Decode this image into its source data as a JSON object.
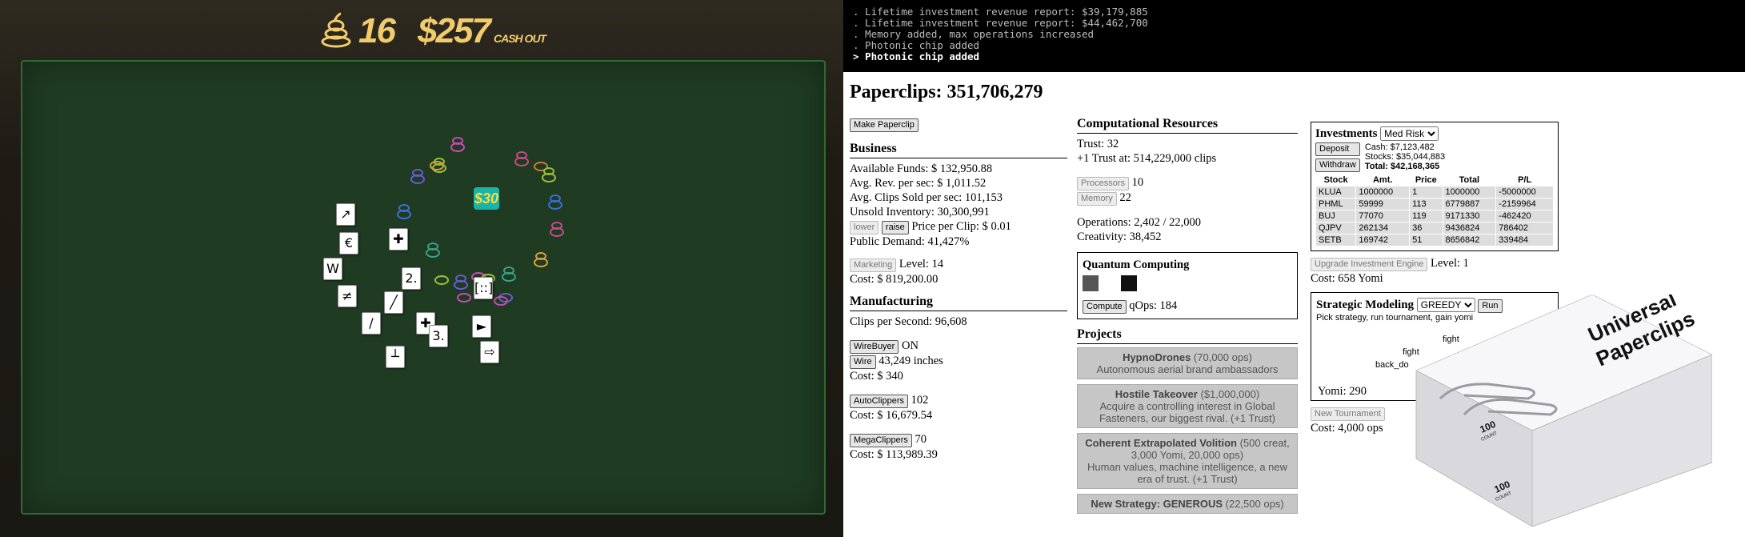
{
  "game": {
    "player_count": "16",
    "money": "$257",
    "cash_out_label": "CASH OUT",
    "chip_label": "$30",
    "cards": [
      "↗",
      "€",
      "W",
      "≠",
      "✚",
      "2.",
      "╱",
      "/",
      "✚",
      "3.",
      "►",
      "⇨",
      "┴",
      "[::]",
      "┘",
      "∕"
    ]
  },
  "console": {
    "lines": [
      ". Lifetime investment revenue report: $39,179,885",
      ". Lifetime investment revenue report: $44,462,700",
      ". Memory added, max operations increased",
      ". Photonic chip added"
    ],
    "last_line": "> Photonic chip added"
  },
  "paperclips": {
    "title": "Paperclips: 351,706,279",
    "make_button": "Make Paperclip",
    "business": {
      "heading": "Business",
      "funds": "Available Funds: $ 132,950.88",
      "rev": "Avg. Rev. per sec: $ 1,011.52",
      "sold": "Avg. Clips Sold per sec: 101,153",
      "unsold": "Unsold Inventory: 30,300,991",
      "lower": "lower",
      "raise": "raise",
      "price": "Price per Clip: $ 0.01",
      "demand": "Public Demand: 41,427%",
      "marketing_btn": "Marketing",
      "marketing_level": "Level: 14",
      "marketing_cost": "Cost: $ 819,200.00"
    },
    "manufacturing": {
      "heading": "Manufacturing",
      "cps": "Clips per Second: 96,608",
      "wirebuyer_btn": "WireBuyer",
      "wirebuyer_state": "ON",
      "wire_btn": "Wire",
      "wire_amt": "43,249 inches",
      "wire_cost": "Cost: $ 340",
      "auto_btn": "AutoClippers",
      "auto_count": "102",
      "auto_cost": "Cost: $ 16,679.54",
      "mega_btn": "MegaClippers",
      "mega_count": "70",
      "mega_cost": "Cost: $ 113,989.39"
    },
    "computational": {
      "heading": "Computational Resources",
      "trust": "Trust: 32",
      "next_trust": "+1 Trust at: 514,229,000 clips",
      "processors_btn": "Processors",
      "processors": "10",
      "memory_btn": "Memory",
      "memory": "22",
      "operations": "Operations: 2,402 / 22,000",
      "creativity": "Creativity: 38,452"
    },
    "quantum": {
      "heading": "Quantum Computing",
      "compute_btn": "Compute",
      "qops": "qOps: 184"
    },
    "projects": {
      "heading": "Projects",
      "items": [
        {
          "title": "HypnoDrones",
          "cost": "(70,000 ops)",
          "desc": "Autonomous aerial brand ambassadors"
        },
        {
          "title": "Hostile Takeover",
          "cost": "($1,000,000)",
          "desc": "Acquire a controlling interest in Global Fasteners, our biggest rival. (+1 Trust)"
        },
        {
          "title": "Coherent Extrapolated Volition",
          "cost": "(500 creat, 3,000 Yomi, 20,000 ops)",
          "desc": "Human values, machine intelligence, a new era of trust. (+1 Trust)"
        },
        {
          "title": "New Strategy: GENEROUS",
          "cost": "(22,500 ops)",
          "desc": ""
        }
      ]
    },
    "investments": {
      "heading": "Investments",
      "risk": "Med Risk",
      "deposit_btn": "Deposit",
      "withdraw_btn": "Withdraw",
      "cash": "Cash: $7,123,482",
      "stocks": "Stocks: $35,044,883",
      "total": "Total: $42,168,365",
      "columns": [
        "Stock",
        "Amt.",
        "Price",
        "Total",
        "P/L"
      ],
      "rows": [
        [
          "KLUA",
          "1000000",
          "1",
          "1000000",
          "-5000000"
        ],
        [
          "PHML",
          "59999",
          "113",
          "6779887",
          "-2159964"
        ],
        [
          "BUJ",
          "77070",
          "119",
          "9171330",
          "-462420"
        ],
        [
          "QJPV",
          "262134",
          "36",
          "9436824",
          "786402"
        ],
        [
          "SETB",
          "169742",
          "51",
          "8656842",
          "339484"
        ]
      ],
      "upgrade_btn": "Upgrade Investment Engine",
      "level": "Level: 1",
      "cost": "Cost: 658 Yomi"
    },
    "strategic": {
      "heading": "Strategic Modeling",
      "strategy": "GREEDY",
      "run_btn": "Run",
      "desc": "Pick strategy, run tournament, gain yomi",
      "label_fight1": "fight",
      "label_fight2": "fight",
      "label_back": "back_do",
      "yomi": "Yomi: 290",
      "new_tournament_btn": "New Tournament",
      "cost": "Cost: 4,000 ops"
    },
    "box": {
      "brand": "Universal Paperclips",
      "count_top": "100",
      "count_sub": "COUNT",
      "count_side": "100",
      "count_side_sub": "COUNT"
    }
  }
}
